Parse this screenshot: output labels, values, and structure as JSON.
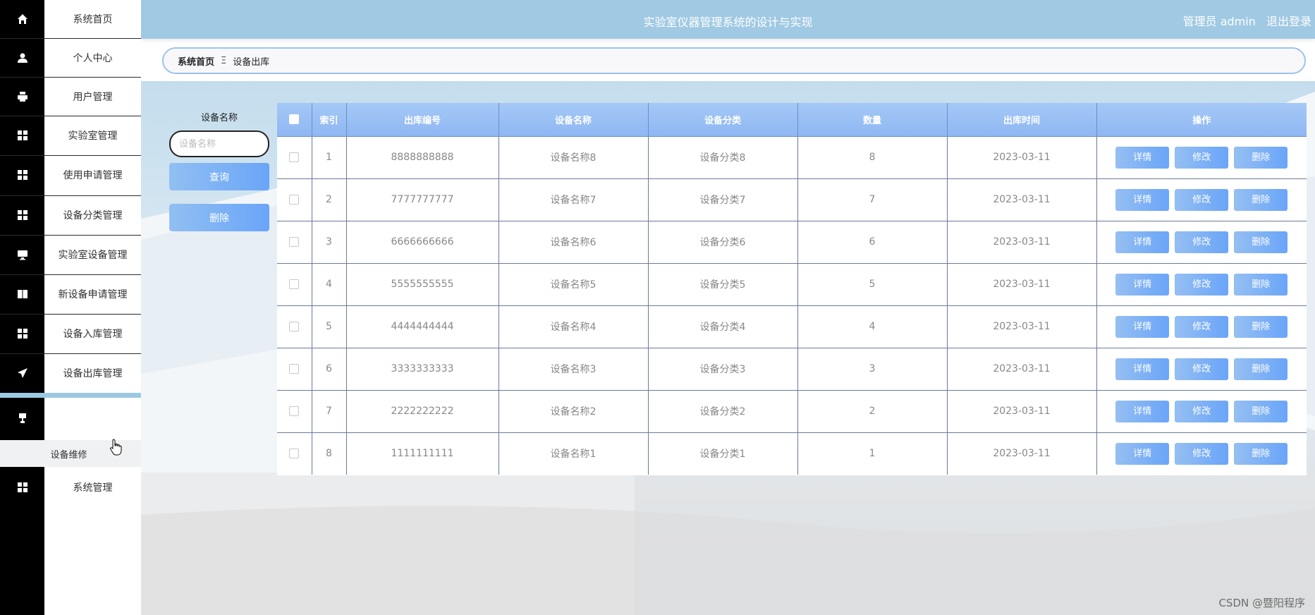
{
  "header": {
    "title": "实验室仪器管理系统的设计与实现",
    "role": "管理员 admin",
    "logout": "退出登录"
  },
  "sidebar": {
    "items": [
      {
        "label": "系统首页",
        "icon": "home-icon"
      },
      {
        "label": "个人中心",
        "icon": "user-icon"
      },
      {
        "label": "用户管理",
        "icon": "printer-icon"
      },
      {
        "label": "实验室管理",
        "icon": "grid-icon"
      },
      {
        "label": "使用申请管理",
        "icon": "grid-icon"
      },
      {
        "label": "设备分类管理",
        "icon": "grid-icon"
      },
      {
        "label": "实验室设备管理",
        "icon": "monitor-icon"
      },
      {
        "label": "新设备申请管理",
        "icon": "book-icon"
      },
      {
        "label": "设备入库管理",
        "icon": "grid-icon"
      },
      {
        "label": "设备出库管理",
        "icon": "send-icon"
      },
      {
        "label": "",
        "icon": "stamp-icon"
      },
      {
        "label": "系统管理",
        "icon": "grid-icon"
      }
    ],
    "submenu_label": "设备维修"
  },
  "breadcrumb": {
    "home": "系统首页",
    "separator": "Ξ",
    "current": "设备出库"
  },
  "search": {
    "label": "设备名称",
    "placeholder": "设备名称",
    "query_button": "查询",
    "delete_button": "删除"
  },
  "table": {
    "headers": [
      "索引",
      "出库编号",
      "设备名称",
      "设备分类",
      "数量",
      "出库时间",
      "操作"
    ],
    "actions": {
      "detail": "详情",
      "edit": "修改",
      "delete": "删除"
    },
    "rows": [
      {
        "index": "1",
        "code": "8888888888",
        "name": "设备名称8",
        "category": "设备分类8",
        "qty": "8",
        "time": "2023-03-11"
      },
      {
        "index": "2",
        "code": "7777777777",
        "name": "设备名称7",
        "category": "设备分类7",
        "qty": "7",
        "time": "2023-03-11"
      },
      {
        "index": "3",
        "code": "6666666666",
        "name": "设备名称6",
        "category": "设备分类6",
        "qty": "6",
        "time": "2023-03-11"
      },
      {
        "index": "4",
        "code": "5555555555",
        "name": "设备名称5",
        "category": "设备分类5",
        "qty": "5",
        "time": "2023-03-11"
      },
      {
        "index": "5",
        "code": "4444444444",
        "name": "设备名称4",
        "category": "设备分类4",
        "qty": "4",
        "time": "2023-03-11"
      },
      {
        "index": "6",
        "code": "3333333333",
        "name": "设备名称3",
        "category": "设备分类3",
        "qty": "3",
        "time": "2023-03-11"
      },
      {
        "index": "7",
        "code": "2222222222",
        "name": "设备名称2",
        "category": "设备分类2",
        "qty": "2",
        "time": "2023-03-11"
      },
      {
        "index": "8",
        "code": "1111111111",
        "name": "设备名称1",
        "category": "设备分类1",
        "qty": "1",
        "time": "2023-03-11"
      }
    ]
  },
  "watermark": "CSDN @暨阳程序",
  "colors": {
    "header_bg": "#a0c9e3",
    "sidebar_icon_bg": "#000000",
    "button_gradient_start": "#91bff2",
    "button_gradient_end": "#6aa5f8",
    "table_header": "#9cc0f5"
  }
}
